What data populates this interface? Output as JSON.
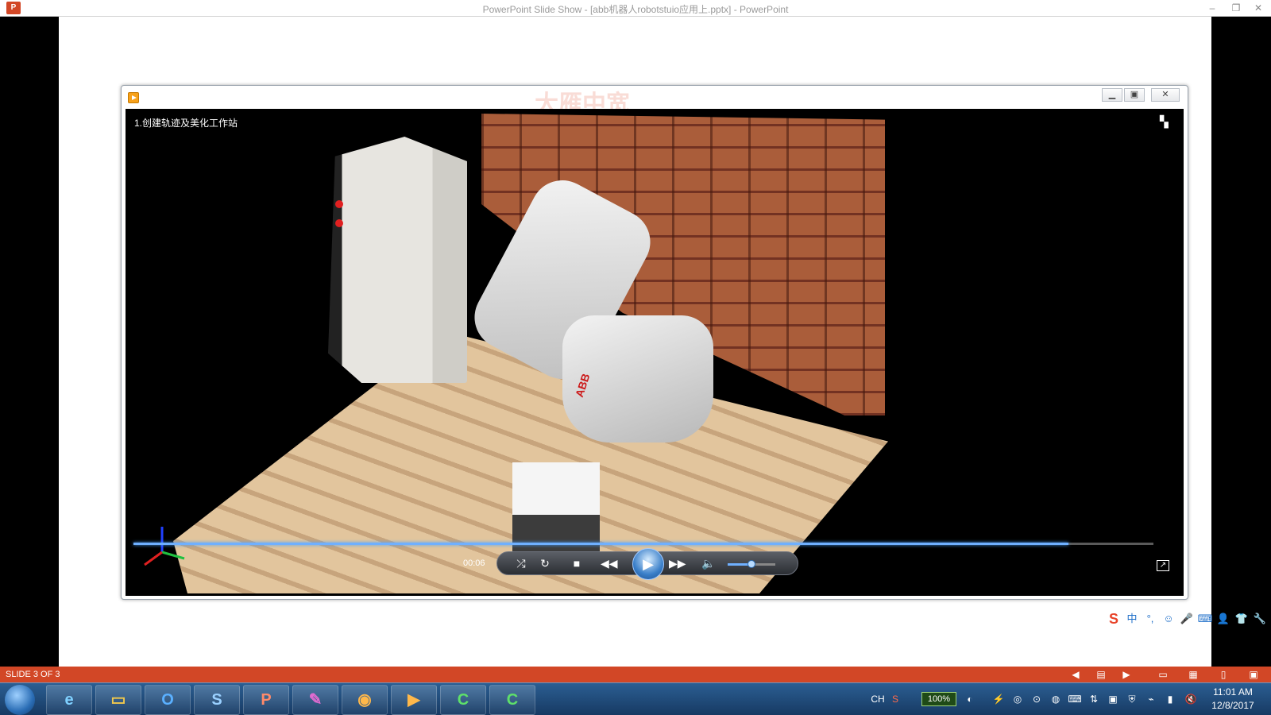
{
  "window": {
    "title": "PowerPoint Slide Show - [abb机器人robotstuio应用上.pptx] - PowerPoint",
    "app_icon": "P"
  },
  "player": {
    "video_title": "1.创建轨迹及美化工作站",
    "watermark": "大雁中宽",
    "time": "00:06",
    "seek_progress": 0.917,
    "volume": 0.5,
    "robot_brand": "ABB"
  },
  "ime": {
    "items": [
      "S",
      "中",
      "°,",
      "☺",
      "🎤",
      "⌨",
      "👤",
      "👕",
      "🔧"
    ]
  },
  "statusbar": {
    "slide_label": "SLIDE 3 OF 3"
  },
  "taskbar": {
    "input_lang": "CH",
    "battery": "100%",
    "time": "11:01 AM",
    "date": "12/8/2017"
  },
  "colors": {
    "powerpoint_orange": "#d24726",
    "player_accent": "#3a7fc9"
  }
}
